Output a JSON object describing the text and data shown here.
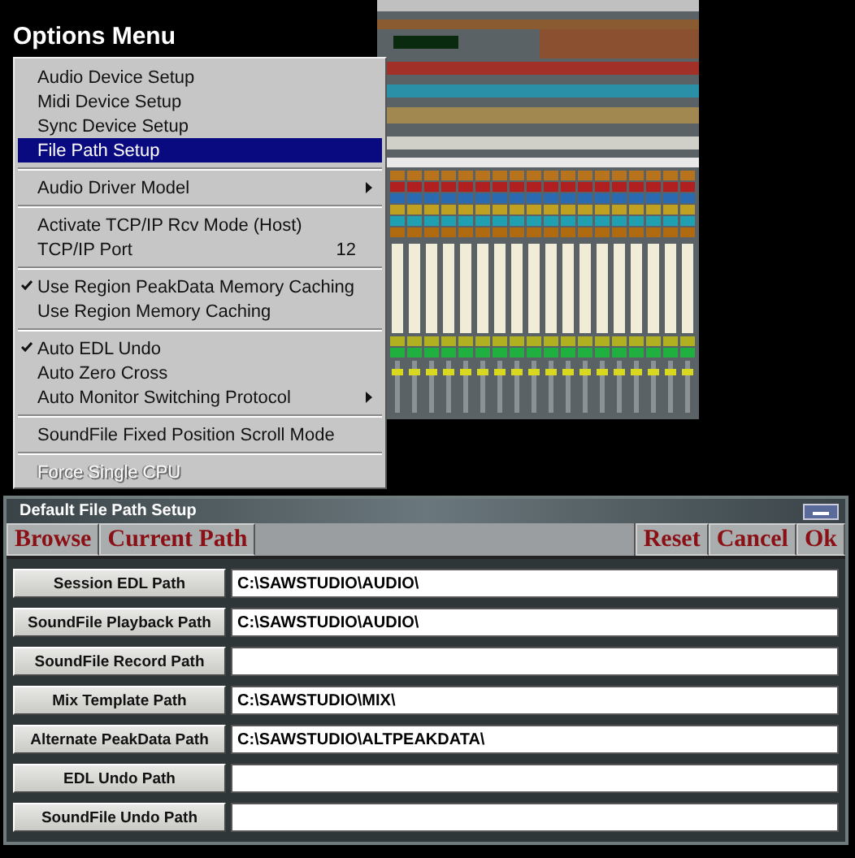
{
  "title": "Options Menu",
  "menu": {
    "groups": [
      {
        "items": [
          {
            "label": "Audio Device Setup",
            "selected": false,
            "checked": false,
            "submenu": false,
            "disabled": false
          },
          {
            "label": "Midi Device Setup",
            "selected": false,
            "checked": false,
            "submenu": false,
            "disabled": false
          },
          {
            "label": "Sync Device Setup",
            "selected": false,
            "checked": false,
            "submenu": false,
            "disabled": false
          },
          {
            "label": "File Path Setup",
            "selected": true,
            "checked": false,
            "submenu": false,
            "disabled": false
          }
        ]
      },
      {
        "items": [
          {
            "label": "Audio Driver Model",
            "selected": false,
            "checked": false,
            "submenu": true,
            "disabled": false
          }
        ]
      },
      {
        "items": [
          {
            "label": "Activate TCP/IP Rcv Mode (Host)",
            "selected": false,
            "checked": false,
            "submenu": false,
            "disabled": false
          },
          {
            "label": "TCP/IP Port",
            "value": "12",
            "selected": false,
            "checked": false,
            "submenu": false,
            "disabled": false
          }
        ]
      },
      {
        "items": [
          {
            "label": "Use Region PeakData Memory Caching",
            "selected": false,
            "checked": true,
            "submenu": false,
            "disabled": false
          },
          {
            "label": "Use Region Memory Caching",
            "selected": false,
            "checked": false,
            "submenu": false,
            "disabled": false
          }
        ]
      },
      {
        "items": [
          {
            "label": "Auto EDL Undo",
            "selected": false,
            "checked": true,
            "submenu": false,
            "disabled": false
          },
          {
            "label": "Auto Zero Cross",
            "selected": false,
            "checked": false,
            "submenu": false,
            "disabled": false
          },
          {
            "label": "Auto Monitor Switching Protocol",
            "selected": false,
            "checked": false,
            "submenu": true,
            "disabled": false
          }
        ]
      },
      {
        "items": [
          {
            "label": "SoundFile Fixed Position Scroll Mode",
            "selected": false,
            "checked": false,
            "submenu": false,
            "disabled": false
          }
        ]
      },
      {
        "items": [
          {
            "label": "Force Single CPU",
            "selected": false,
            "checked": false,
            "submenu": false,
            "disabled": true
          }
        ]
      }
    ]
  },
  "dialog": {
    "title": "Default File Path Setup",
    "toolbar_left": [
      "Browse",
      "Current Path"
    ],
    "toolbar_right": [
      "Reset",
      "Cancel",
      "Ok"
    ],
    "paths": [
      {
        "label": "Session EDL Path",
        "value": "C:\\SAWSTUDIO\\AUDIO\\"
      },
      {
        "label": "SoundFile Playback Path",
        "value": "C:\\SAWSTUDIO\\AUDIO\\"
      },
      {
        "label": "SoundFile Record Path"
      },
      {
        "label": "Mix Template Path",
        "value": "C:\\SAWSTUDIO\\MIX\\"
      },
      {
        "label": "Alternate PeakData Path",
        "value": "C:\\SAWSTUDIO\\ALTPEAKDATA\\"
      },
      {
        "label": "EDL Undo Path"
      },
      {
        "label": "SoundFile Undo Path"
      }
    ]
  }
}
